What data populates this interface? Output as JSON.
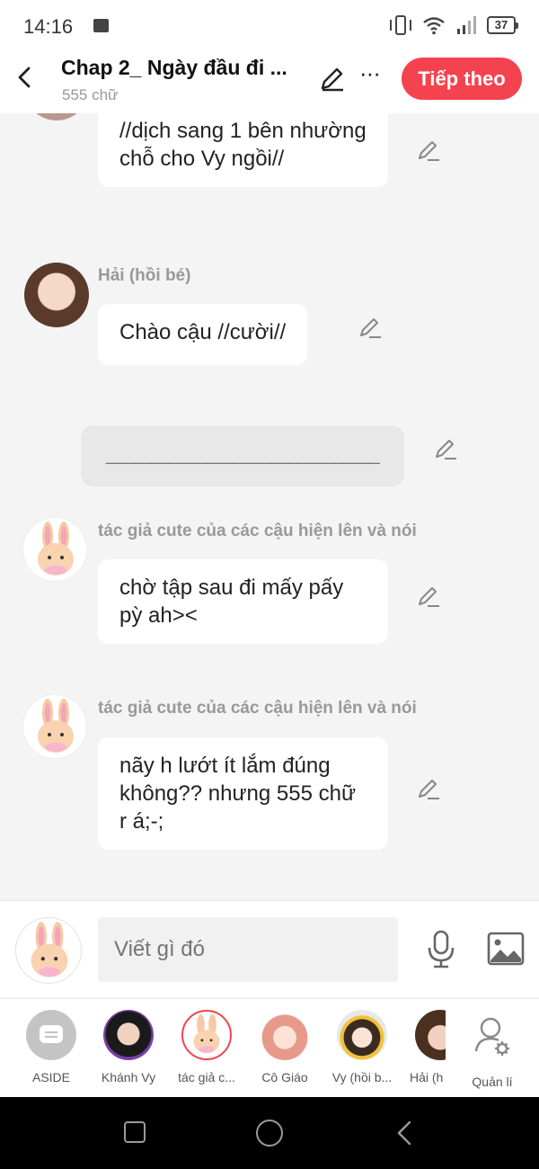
{
  "status_bar": {
    "time": "14:16",
    "battery": "37",
    "icons": [
      "gallery-icon",
      "vibrate-icon",
      "wifi-icon",
      "signal-icon",
      "battery-icon"
    ]
  },
  "header": {
    "title": "Chap 2_ Ngày đầu đi ...",
    "word_count": "555 chữ",
    "next_button": "Tiếp theo",
    "accent_color": "#f5424f"
  },
  "messages": [
    {
      "speaker": "",
      "text": "//dịch sang 1 bên nhường chỗ cho Vy ngồi//"
    },
    {
      "speaker": "Hải (hồi bé)",
      "text": "Chào cậu //cười//"
    },
    {
      "type": "divider",
      "text": "______________________________"
    },
    {
      "speaker": "tác giả cute của các cậu hiện lên và nói",
      "text": "chờ tập sau đi mấy pấy pỳ ah><"
    },
    {
      "speaker": "tác giả cute của các cậu hiện lên và nói",
      "text": "nãy h lướt ít lắm đúng không?? nhưng 555 chữ r á;-;"
    }
  ],
  "composer": {
    "placeholder": "Viết gì đó"
  },
  "characters": [
    {
      "label": "ASIDE",
      "icon": "aside-icon"
    },
    {
      "label": "Khánh Vy"
    },
    {
      "label": "tác giả c...",
      "selected": true
    },
    {
      "label": "Cô Giáo"
    },
    {
      "label": "Vy (hồi b..."
    },
    {
      "label": "Hải (h"
    },
    {
      "label": "Quản lí",
      "icon": "manage-characters-icon"
    }
  ]
}
